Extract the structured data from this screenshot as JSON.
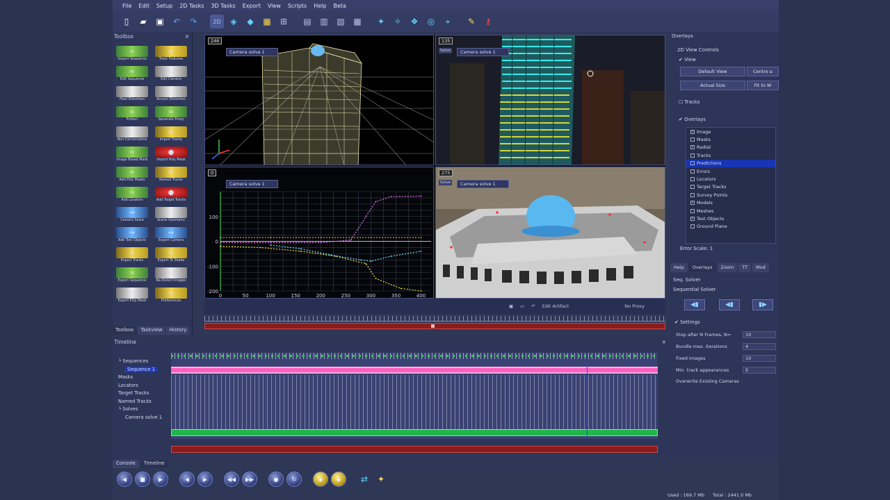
{
  "menu": [
    "File",
    "Edit",
    "Setup",
    "2D Tasks",
    "3D Tasks",
    "Export",
    "View",
    "Scripts",
    "Help",
    "Beta"
  ],
  "toolbar": {
    "icons": [
      "new-file-icon",
      "open-folder-icon",
      "save-icon",
      "undo-icon",
      "redo-icon",
      "view-2d-icon",
      "view-3d-icon",
      "camera-view-icon",
      "image-view-icon",
      "layout-quad-icon",
      "layout-single-icon",
      "layout-horizontal-icon",
      "layout-vertical-icon",
      "layout-grid-icon",
      "track-icon",
      "solve-icon",
      "refine-icon",
      "orbit-icon",
      "zoom-fit-icon",
      "pin-icon",
      "key-icon"
    ],
    "view_2d_label": "2D"
  },
  "toolbox": {
    "title": "Toolbox",
    "tools": [
      {
        "label": "Import Sequence",
        "style": "g"
      },
      {
        "label": "Track Features",
        "style": "y"
      },
      {
        "label": "Edit Sequence",
        "style": "g"
      },
      {
        "label": "Edit Camera",
        "style": "w"
      },
      {
        "label": "Pixel Distortion",
        "style": "w"
      },
      {
        "label": "Access Distortion",
        "style": "w"
      },
      {
        "label": "Protect",
        "style": "g"
      },
      {
        "label": "Generate Proxy",
        "style": "g"
      },
      {
        "label": "Non-Conservative",
        "style": "w"
      },
      {
        "label": "Import Tracks",
        "style": "y"
      },
      {
        "label": "Image Based Mask",
        "style": "g"
      },
      {
        "label": "Import Poly Mask",
        "style": "r"
      },
      {
        "label": "Add Poly Masks",
        "style": "g"
      },
      {
        "label": "Named Tracks",
        "style": "y"
      },
      {
        "label": "Add Locators",
        "style": "g"
      },
      {
        "label": "Add Target Tracks",
        "style": "r"
      },
      {
        "label": "Camera Solve",
        "style": "b"
      },
      {
        "label": "Scene Geometry",
        "style": "w"
      },
      {
        "label": "Add Test Objects",
        "style": "b"
      },
      {
        "label": "Export Camera",
        "style": "b"
      },
      {
        "label": "Export Tracks",
        "style": "y"
      },
      {
        "label": "Export To Shake",
        "style": "y"
      },
      {
        "label": "Export Sequence",
        "style": "g"
      },
      {
        "label": "Re-Distort Images",
        "style": "w"
      },
      {
        "label": "Export Poly Mask",
        "style": "w"
      },
      {
        "label": "Preferences",
        "style": "y"
      }
    ],
    "tabs": [
      "Toolbox",
      "Taskview",
      "History"
    ]
  },
  "viewports": {
    "tl": {
      "frame": "246",
      "solve": "Camera solve 1"
    },
    "tr": {
      "frame": "135",
      "solve": "Camera solve 1",
      "solve_btn": "Solve"
    },
    "bl": {
      "frame": "0",
      "solve": "Camera solve 1"
    },
    "br": {
      "frame": "275",
      "solve": "Camera solve 1",
      "solve_btn": "Solve"
    }
  },
  "chart_data": {
    "type": "line",
    "title": "",
    "xlabel": "",
    "ylabel": "",
    "xlim": [
      0,
      420
    ],
    "ylim": [
      -200,
      200
    ],
    "x_ticks": [
      0,
      50,
      100,
      150,
      200,
      250,
      300,
      350,
      400
    ],
    "y_ticks": [
      100,
      0,
      -100,
      -200
    ],
    "grid": true,
    "series": [
      {
        "color": "#d86ee6",
        "x": [
          0,
          100,
          200,
          260,
          290,
          310,
          340,
          400
        ],
        "y": [
          -5,
          -5,
          -5,
          5,
          100,
          160,
          180,
          182
        ]
      },
      {
        "color": "#d0a040",
        "x": [
          0,
          100,
          200,
          300,
          400
        ],
        "y": [
          15,
          15,
          15,
          15,
          15
        ]
      },
      {
        "color": "#e0d040",
        "x": [
          0,
          80,
          160,
          230,
          290,
          310,
          360,
          400
        ],
        "y": [
          -20,
          -25,
          -40,
          -60,
          -90,
          -150,
          -190,
          -200
        ]
      },
      {
        "color": "#6ad0e6",
        "x": [
          100,
          160,
          220,
          280,
          300,
          340,
          400
        ],
        "y": [
          -15,
          -30,
          -55,
          -75,
          -80,
          -60,
          -40
        ]
      }
    ]
  },
  "viewbar": {
    "edit_artifact": "Edit Artifact",
    "proxy": "No Proxy"
  },
  "overlays": {
    "title": "Overlays",
    "view_controls": "2D View Controls",
    "view_label": "View",
    "buttons": [
      "Default View",
      "Centre a",
      "Actual Size",
      "Fit to W"
    ],
    "tracks_label": "Tracks",
    "overlays_label": "Overlays",
    "items": [
      {
        "label": "Image",
        "checked": "✓"
      },
      {
        "label": "Masks",
        "checked": ""
      },
      {
        "label": "Radial",
        "checked": "✓"
      },
      {
        "label": "Tracks",
        "checked": ""
      },
      {
        "label": "Predictions",
        "checked": "",
        "selected": true
      },
      {
        "label": "Errors",
        "checked": ""
      },
      {
        "label": "Locators",
        "checked": ""
      },
      {
        "label": "Target Tracks",
        "checked": ""
      },
      {
        "label": "Survey Points",
        "checked": ""
      },
      {
        "label": "Models",
        "checked": "✓"
      },
      {
        "label": "Meshes",
        "checked": ""
      },
      {
        "label": "Test Objects",
        "checked": "✓"
      },
      {
        "label": "Ground Plane",
        "checked": ""
      }
    ],
    "error_scale": "Error Scale: 1",
    "tabs": [
      "Help",
      "Overlays",
      "Zoom",
      "TT",
      "Mod"
    ],
    "seq_solver": "Seq. Solver",
    "sequential_solver": "Sequential Solver",
    "settings_label": "Settings",
    "settings": [
      {
        "label": "Stop after N Frames, N=",
        "value": "10"
      },
      {
        "label": "Bundle max. iterations",
        "value": "4"
      },
      {
        "label": "Fixed images",
        "value": "10"
      },
      {
        "label": "Min. track appearances",
        "value": "5"
      },
      {
        "label": "Overwrite Existing Cameras",
        "value": ""
      }
    ]
  },
  "timeline": {
    "title": "Timeline",
    "tree": [
      "Sequences",
      "Sequence 1",
      "Masks",
      "Locators",
      "Target Tracks",
      "Named Tracks",
      "Solves",
      "Camera solve 1"
    ],
    "tabs": [
      "Console",
      "Timeline"
    ]
  },
  "transport": [
    "prev-icon",
    "stop-icon",
    "play-icon",
    "step-back-icon",
    "step-forward-icon",
    "rewind-icon",
    "fast-forward-icon",
    "record-icon",
    "loop-icon",
    "key-prev-icon",
    "key-next-icon",
    "sync-icon",
    "camera-icon"
  ],
  "status": {
    "used": "Used : 169.7 Mb",
    "total": "Total : 2441.0 Mb"
  }
}
